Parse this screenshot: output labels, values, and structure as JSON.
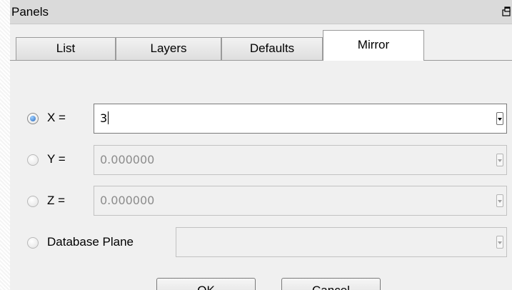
{
  "window": {
    "title": "Panels"
  },
  "tabs": [
    {
      "label": "List"
    },
    {
      "label": "Layers"
    },
    {
      "label": "Defaults"
    },
    {
      "label": "Mirror",
      "active": true
    }
  ],
  "mirror": {
    "options": [
      {
        "label": "X =",
        "value": "3",
        "checked": true,
        "enabled": true
      },
      {
        "label": "Y =",
        "value": "0.000000",
        "checked": false,
        "enabled": false
      },
      {
        "label": "Z =",
        "value": "0.000000",
        "checked": false,
        "enabled": false
      },
      {
        "label": "Database Plane",
        "value": "",
        "checked": false,
        "enabled": false
      }
    ]
  },
  "buttons": {
    "ok": "OK",
    "cancel": "Cancel"
  }
}
